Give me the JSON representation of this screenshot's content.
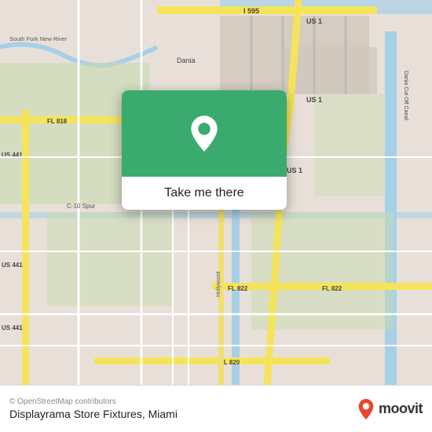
{
  "map": {
    "attribution": "© OpenStreetMap contributors",
    "bg_color": "#e8e0d8",
    "road_color_major": "#f5e97a",
    "road_color_minor": "#ffffff",
    "water_color": "#b3d4e8",
    "green_color": "#c8dbb0"
  },
  "card": {
    "button_label": "Take me there",
    "bg_color": "#3aaa6e",
    "pin_color": "#ffffff"
  },
  "footer": {
    "attribution": "© OpenStreetMap contributors",
    "location_label": "Displayrama Store Fixtures, Miami"
  },
  "moovit": {
    "label": "moovit",
    "pin_color": "#e8472a"
  }
}
